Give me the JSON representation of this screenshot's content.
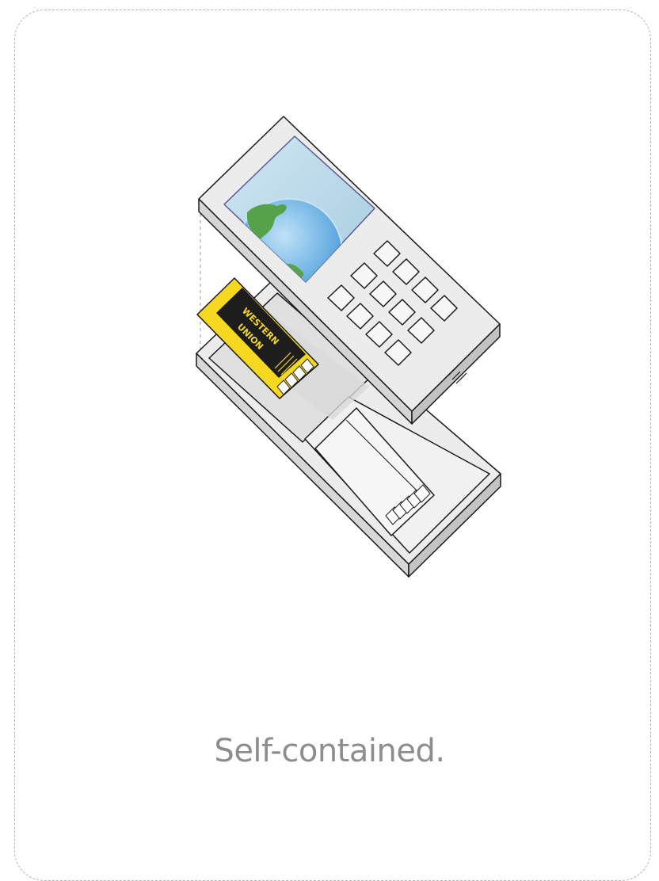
{
  "caption": "Self-contained.",
  "card_logo": {
    "line1": "WESTERN",
    "line2": "UNION"
  },
  "colors": {
    "border": "#b5b5b5",
    "caption": "#8d8d8d",
    "card_yellow": "#f6d820",
    "device": "#ececec",
    "device_outline": "#1a1a1a",
    "screen_blue": "#7fb8e0",
    "globe_green": "#55a24a"
  },
  "icons": [
    "device-icon",
    "globe-icon",
    "keypad-icon",
    "memory-card-icon"
  ]
}
